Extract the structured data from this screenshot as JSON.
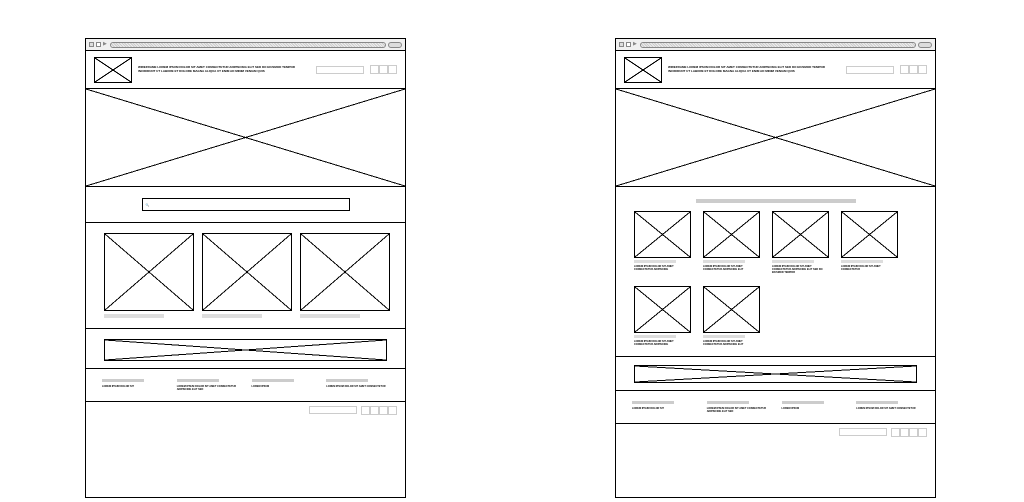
{
  "browser": {
    "forward_icon": "▶"
  },
  "wireframe_left": {
    "tagline": "WIREFRAME LOREM IPSUM DOLOR SIT AMET CONSECTETUR ADIPISCING ELIT SED DO EIUSMOD TEMPOR INCIDIDUNT UT LABORE ET DOLORE MAGNA ALIQUA UT ENIM AD MINIM VENIAM QUIS",
    "search_icon": "🔍",
    "footer": {
      "col1": "LOREM IPSUM DOLOR SIT",
      "col2": "LOREM IPSUM DOLOR SIT AMET CONSECTETUR ADIPISCING ELIT SED",
      "col3": "LOREM IPSUM",
      "col4": "LOREM IPSUM DOLOR SIT AMET CONSECTETUR"
    }
  },
  "wireframe_right": {
    "tagline": "WIREFRAME LOREM IPSUM DOLOR SIT AMET CONSECTETUR ADIPISCING ELIT SED DO EIUSMOD TEMPOR INCIDIDUNT UT LABORE ET DOLORE MAGNA ALIQUA UT ENIM AD MINIM VENIAM QUIS",
    "grid": {
      "item1": "LOREM IPSUM DOLOR SIT AMET CONSECTETUR ADIPISCING",
      "item2": "LOREM IPSUM DOLOR SIT AMET CONSECTETUR ADIPISCING ELIT",
      "item3": "LOREM IPSUM DOLOR SIT AMET CONSECTETUR ADIPISCING ELIT SED DO EIUSMOD TEMPOR",
      "item4": "LOREM IPSUM DOLOR SIT AMET CONSECTETUR",
      "item5": "LOREM IPSUM DOLOR SIT AMET CONSECTETUR ADIPISCING",
      "item6": "LOREM IPSUM DOLOR SIT AMET CONSECTETUR ADIPISCING ELIT"
    },
    "footer": {
      "col1": "LOREM IPSUM DOLOR SIT",
      "col2": "LOREM IPSUM DOLOR SIT AMET CONSECTETUR ADIPISCING ELIT SED",
      "col3": "LOREM IPSUM",
      "col4": "LOREM IPSUM DOLOR SIT AMET CONSECTETUR"
    }
  }
}
